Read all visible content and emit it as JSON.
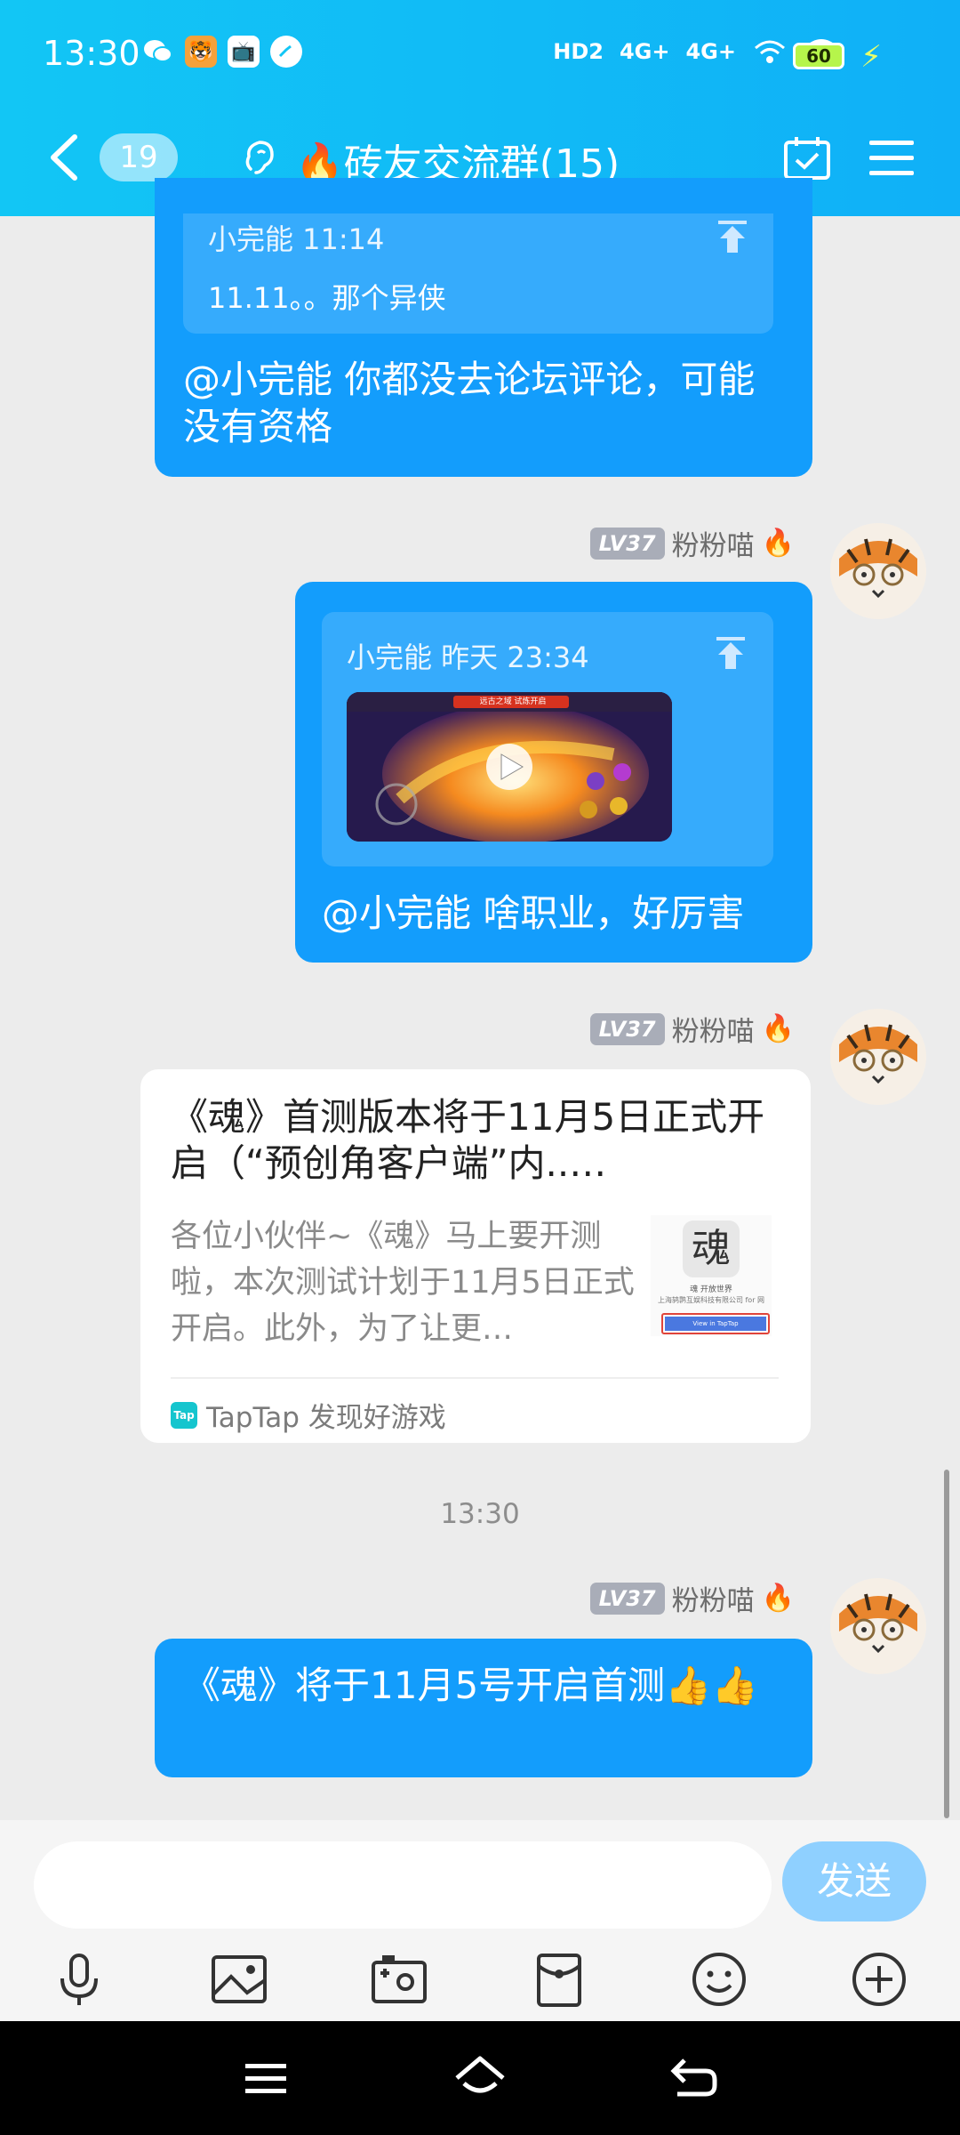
{
  "status_bar": {
    "time": "13:30",
    "network": [
      "HD2",
      "4G+",
      "4G+"
    ],
    "battery": "60"
  },
  "nav": {
    "unread_count": "19",
    "title": "🔥砖友交流群(15)"
  },
  "messages": [
    {
      "quote_author_time": "小完能 11:14",
      "quote_text": "11.11。。那个异侠",
      "text": "@小完能 你都没去论坛评论，可能没有资格"
    },
    {
      "sender_level": "LV37",
      "sender_name": "粉粉喵",
      "quote_author_time": "小完能 昨天 23:34",
      "video_banner": "远古之域 试炼开启",
      "text": "@小完能 啥职业，好厉害"
    },
    {
      "sender_level": "LV37",
      "sender_name": "粉粉喵",
      "card_title": "《魂》首测版本将于11月5日正式开启（“预创角客户端”内..…",
      "card_desc": "各位小伙伴~《魂》马上要开测啦，本次测试计划于11月5日正式开启。此外，为了让更…",
      "card_thumb_name": "魂 开放世界",
      "card_thumb_company": "上海鸫鹮互娱科技有限公司 for 网",
      "card_thumb_button": "View in TapTap",
      "card_source": "TapTap 发现好游戏"
    },
    {
      "sender_level": "LV37",
      "sender_name": "粉粉喵",
      "text": "《魂》将于11月5号开启首测👍👍"
    }
  ],
  "timestamp": "13:30",
  "input": {
    "placeholder": "",
    "send_label": "发送"
  },
  "toolbar_icons": [
    "microphone-icon",
    "image-icon",
    "camera-icon",
    "red-packet-icon",
    "emoji-icon",
    "plus-icon"
  ],
  "colors": {
    "header": "#12c6f5",
    "bubble": "#139dfc",
    "send_button": "#8fd0ff"
  }
}
